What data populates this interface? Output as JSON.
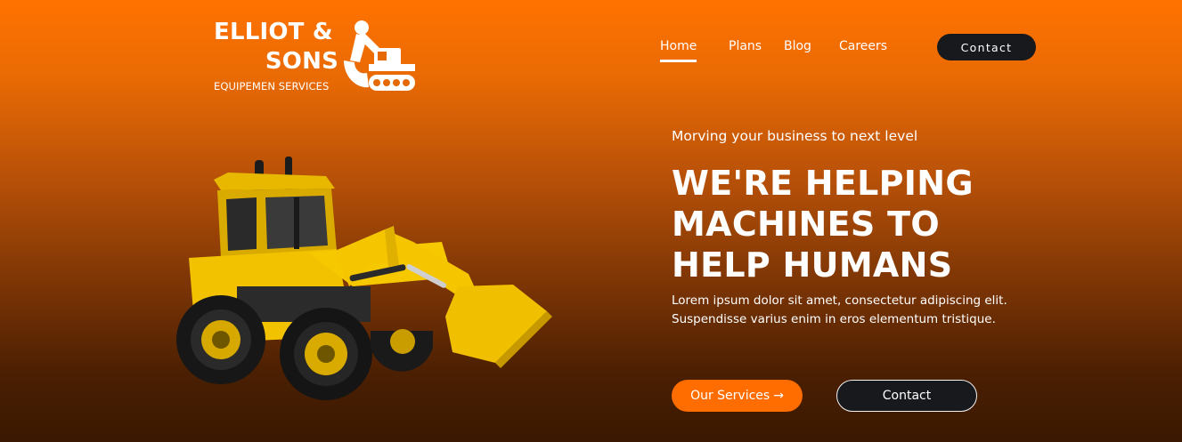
{
  "brand": {
    "title_line1": "ELLIOT &",
    "title_line2": "SONS",
    "subtitle": "EQUIPEMEN SERVICES",
    "icon": "excavator-icon"
  },
  "nav": {
    "items": [
      {
        "label": "Home",
        "active": true
      },
      {
        "label": "Plans",
        "active": false
      },
      {
        "label": "Blog",
        "active": false
      },
      {
        "label": "Careers",
        "active": false
      }
    ],
    "contact_label": "Contact"
  },
  "hero": {
    "tagline": "Morving your business to next level",
    "title_lines": [
      "WE'RE HELPING",
      "MACHINES TO",
      "HELP HUMANS"
    ],
    "body": "Lorem ipsum dolor sit amet, consectetur adipiscing elit. Suspendisse varius enim in eros elementum tristique.",
    "primary_button": "Our Services",
    "primary_button_icon": "→",
    "secondary_button": "Contact",
    "image": "backhoe-loader-image"
  },
  "colors": {
    "accent": "#ff6d00",
    "dark_button": "#17191d",
    "machine_yellow": "#f2c200"
  }
}
